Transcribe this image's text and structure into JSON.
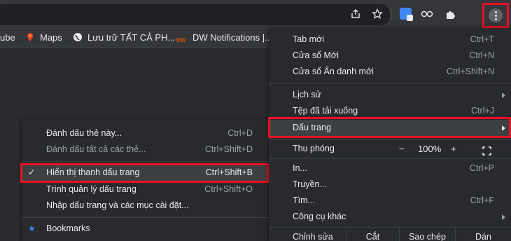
{
  "toolbar": {
    "icons": [
      "share-icon",
      "star-icon",
      "google-translate-icon",
      "reader-icon",
      "extensions-icon",
      "more-vert-icon"
    ]
  },
  "bookmarks": [
    {
      "label": "ube",
      "icon": "youtube-icon"
    },
    {
      "label": "Maps",
      "icon": "maps-pin-icon"
    },
    {
      "label": "Lưu trữ TẤT CẢ PH...",
      "icon": "globe-icon"
    },
    {
      "label": "DW Notifications |...",
      "icon": "dw-icon"
    }
  ],
  "main_menu": {
    "items": [
      {
        "label": "Tab mới",
        "shortcut": "Ctrl+T"
      },
      {
        "label": "Cửa sổ Mới",
        "shortcut": "Ctrl+N"
      },
      {
        "label": "Cửa sổ Ẩn danh mới",
        "shortcut": "Ctrl+Shift+N"
      },
      {
        "label": "Lịch sử",
        "shortcut": ""
      },
      {
        "label": "Tệp đã tải xuống",
        "shortcut": "Ctrl+J"
      },
      {
        "label": "Dấu trang",
        "shortcut": ""
      },
      {
        "label": "Thu phóng",
        "shortcut": ""
      },
      {
        "label": "In...",
        "shortcut": "Ctrl+P"
      },
      {
        "label": "Truyền...",
        "shortcut": ""
      },
      {
        "label": "Tìm...",
        "shortcut": "Ctrl+F"
      },
      {
        "label": "Công cụ khác",
        "shortcut": ""
      },
      {
        "label": "Chỉnh sửa",
        "shortcut": ""
      }
    ],
    "zoom": {
      "minus": "−",
      "value": "100%",
      "plus": "+"
    },
    "edit": {
      "cut": "Cắt",
      "copy": "Sao chép",
      "paste": "Dán"
    }
  },
  "bookmark_menu": {
    "items": [
      {
        "label": "Đánh dấu thẻ này...",
        "shortcut": "Ctrl+D"
      },
      {
        "label": "Đánh dấu tất cả các thẻ...",
        "shortcut": "Ctrl+Shift+D"
      },
      {
        "label": "Hiển thị thanh dấu trang",
        "shortcut": "Ctrl+Shift+B",
        "checked": true
      },
      {
        "label": "Trình quản lý dấu trang",
        "shortcut": "Ctrl+Shift+O"
      },
      {
        "label": "Nhập dấu trang và các mục cài đặt...",
        "shortcut": ""
      },
      {
        "label": "Bookmarks",
        "shortcut": ""
      }
    ]
  },
  "colors": {
    "highlight": "#e81123",
    "menu_bg": "#292a2d",
    "hover_bg": "#3c4043",
    "text": "#e8eaed"
  }
}
